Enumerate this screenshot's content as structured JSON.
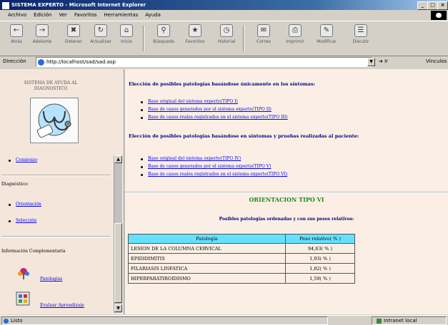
{
  "window": {
    "title": "SISTEMA EXPERTO - Microsoft Internet Explorer"
  },
  "menu": [
    "Archivo",
    "Edición",
    "Ver",
    "Favoritos",
    "Herramientas",
    "Ayuda"
  ],
  "toolbar": {
    "buttons": [
      {
        "label": "Atrás",
        "icon": "back-arrow-icon"
      },
      {
        "label": "Adelante",
        "icon": "forward-arrow-icon"
      },
      {
        "label": "Detener",
        "icon": "stop-icon"
      },
      {
        "label": "Actualizar",
        "icon": "refresh-icon"
      },
      {
        "label": "Inicio",
        "icon": "home-icon"
      },
      {
        "label": "Búsqueda",
        "icon": "search-icon"
      },
      {
        "label": "Favoritos",
        "icon": "favorites-icon"
      },
      {
        "label": "Historial",
        "icon": "history-icon"
      },
      {
        "label": "Correo",
        "icon": "mail-icon"
      },
      {
        "label": "Imprimir",
        "icon": "print-icon"
      },
      {
        "label": "Modificar",
        "icon": "edit-icon"
      },
      {
        "label": "Discutir",
        "icon": "discuss-icon"
      }
    ]
  },
  "address": {
    "label": "Dirección",
    "url": "http://localhost/sad/sad.asp",
    "go": "Ir",
    "links": "Vínculos"
  },
  "left": {
    "system_name": "SISTEMA DE AYUDA AL DIAGNOSTICO",
    "comienzo": "Comienzo",
    "diagnostico_heading": "Diagnóstico:",
    "orientacion": "Orientación",
    "seleccion": "Selección",
    "info_heading": "Información Complementaria",
    "patologias": "Patologías",
    "evaluar": "Evaluar Aprendizaje"
  },
  "right": {
    "heading1": "Elección de posibles patologías basándose únicamente en los síntomas:",
    "links1": [
      "Base original del sistema experto(TIPO I)",
      "Base de casos generados por el sistema experto(TIPO II)",
      "Base de casos reales registrados en el sistema experto(TIPO III)"
    ],
    "heading2": "Elección de posibles patologías basándose en síntomas y pruebas realizadas al paciente:",
    "links2": [
      "Base original del sistema experto(TIPO IV)",
      "Base de casos generados por el sistema experto(TIPO V)",
      "Base de casos reales registrados en el sistema experto(TIPO VI)"
    ],
    "orientation_title": "ORIENTACION TIPO VI",
    "subtitle": "Posibles patologías ordenadas y con sus pesos relativos:"
  },
  "table": {
    "headers": [
      "Patología",
      "Peso relativo( % )"
    ],
    "rows": [
      [
        "LESION DE LA COLUMNA CERVICAL",
        "94,63( % )"
      ],
      [
        "EPIDIDIMITIS",
        "1,93( % )"
      ],
      [
        "FILARIASIS LINFATICA",
        "1,82( % )"
      ],
      [
        "HIPERPARATIROIDISMO",
        "1,59( % )"
      ]
    ]
  },
  "status": {
    "left": "Listo",
    "zone": "Intranet local"
  },
  "colors": {
    "table_header": "#66e0ff",
    "orientation_title": "#1a8a1a",
    "heading": "#000080",
    "link": "#0000ee"
  }
}
